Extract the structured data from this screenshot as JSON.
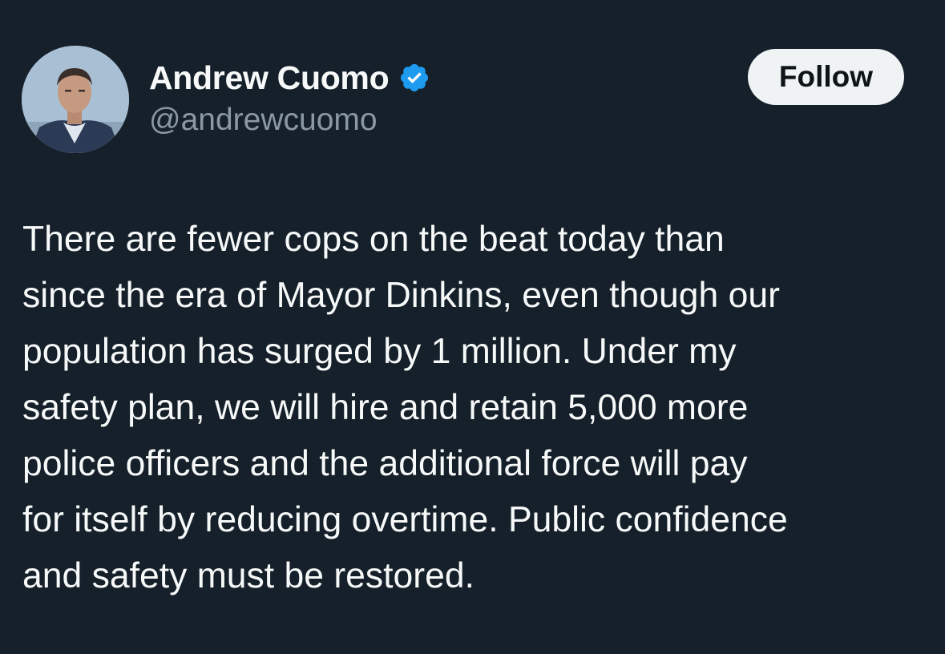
{
  "author": {
    "display_name": "Andrew Cuomo",
    "handle": "@andrewcuomo",
    "verified_icon": "verified-badge-icon",
    "avatar": "profile-photo"
  },
  "follow_button": {
    "label": "Follow"
  },
  "tweet": {
    "lines": [
      "There are fewer cops on the beat today than",
      "since the era of Mayor Dinkins, even though our",
      "population has surged by 1 million. Under my",
      "safety plan, we will hire and retain 5,000 more",
      "police officers and the additional force will pay",
      "for itself by reducing overtime. Public confidence",
      "and safety must be restored."
    ]
  },
  "colors": {
    "background": "#15202b",
    "text_primary": "#f7f9f9",
    "text_secondary": "#8b98a5",
    "verified_blue": "#1d9bf0",
    "follow_button_bg": "#eff3f4",
    "follow_button_text": "#0f1419"
  }
}
